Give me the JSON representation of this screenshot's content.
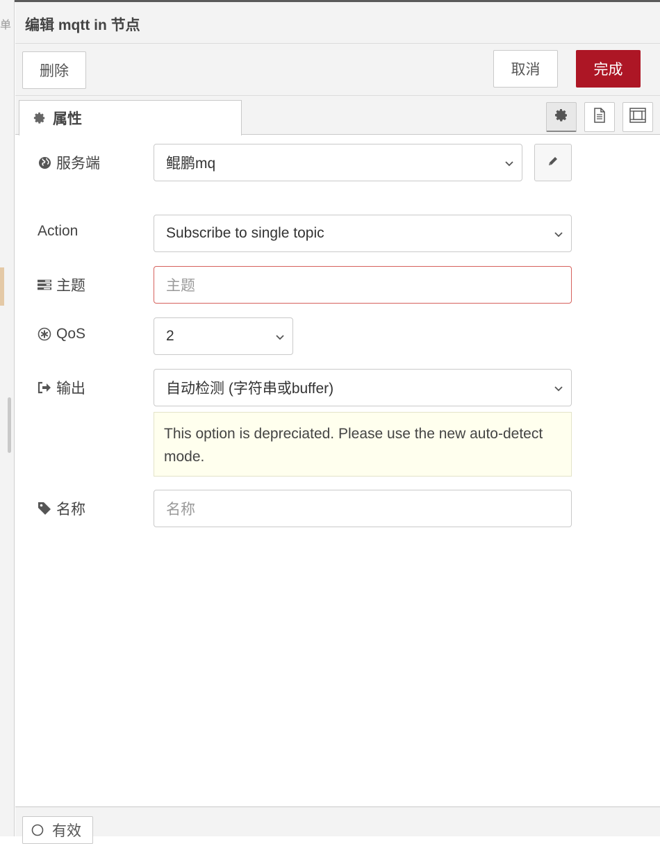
{
  "dialog": {
    "title": "编辑 mqtt in 节点"
  },
  "toolbar": {
    "delete_label": "删除",
    "cancel_label": "取消",
    "done_label": "完成"
  },
  "tabs": {
    "properties_label": "属性"
  },
  "form": {
    "server": {
      "label": "服务端",
      "value": "鲲鹏mq"
    },
    "action": {
      "label": "Action",
      "value": "Subscribe to single topic"
    },
    "topic": {
      "label": "主题",
      "value": "",
      "placeholder": "主题"
    },
    "qos": {
      "label": "QoS",
      "value": "2"
    },
    "output": {
      "label": "输出",
      "value": "自动检测 (字符串或buffer)",
      "warning": "This option is depreciated. Please use the new auto-detect mode."
    },
    "name": {
      "label": "名称",
      "value": "",
      "placeholder": "名称"
    }
  },
  "footer": {
    "status_label": "有效"
  },
  "colors": {
    "accent": "#ad1625",
    "error_border": "#d6615c",
    "warning_bg": "#ffffee"
  },
  "icons": [
    "gear-icon",
    "document-icon",
    "frame-icon",
    "globe-icon",
    "pencil-icon",
    "tasks-icon",
    "asterisk-circle-icon",
    "sign-out-icon",
    "tag-icon",
    "chevron-down-icon",
    "circle-icon"
  ],
  "background_panel": {
    "edge_char": "单"
  }
}
